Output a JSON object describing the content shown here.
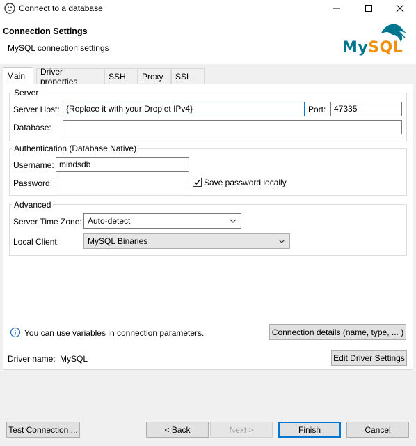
{
  "window": {
    "title": "Connect to a database"
  },
  "header": {
    "title": "Connection Settings",
    "subtitle": "MySQL connection settings",
    "logo_text": "MySQL"
  },
  "tabs": [
    {
      "label": "Main",
      "active": true
    },
    {
      "label": "Driver properties",
      "active": false
    },
    {
      "label": "SSH",
      "active": false
    },
    {
      "label": "Proxy",
      "active": false
    },
    {
      "label": "SSL",
      "active": false
    }
  ],
  "server": {
    "legend": "Server",
    "host_label": "Server Host:",
    "host_value": "{Replace it with your Droplet IPv4}",
    "port_label": "Port:",
    "port_value": "47335",
    "database_label": "Database:",
    "database_value": ""
  },
  "auth": {
    "legend": "Authentication (Database Native)",
    "username_label": "Username:",
    "username_value": "mindsdb",
    "password_label": "Password:",
    "password_value": "",
    "save_password_label": "Save password locally",
    "save_password_checked": true
  },
  "advanced": {
    "legend": "Advanced",
    "timezone_label": "Server Time Zone:",
    "timezone_value": "Auto-detect",
    "local_client_label": "Local Client:",
    "local_client_value": "MySQL Binaries"
  },
  "info": {
    "text": "You can use variables in connection parameters.",
    "details_button": "Connection details (name, type, ... )"
  },
  "driver": {
    "label": "Driver name:",
    "value": "MySQL",
    "edit_button": "Edit Driver Settings"
  },
  "footer": {
    "test_button": "Test Connection ...",
    "back_button": "< Back",
    "next_button": "Next >",
    "finish_button": "Finish",
    "cancel_button": "Cancel"
  },
  "colors": {
    "accent": "#0078d7",
    "mysql_blue": "#00758f",
    "mysql_orange": "#f29111",
    "info_blue": "#1a6fc4"
  },
  "icons": [
    "dbeaver-app-icon",
    "minimize-icon",
    "maximize-icon",
    "close-icon",
    "mysql-dolphin-logo",
    "chevron-down-icon",
    "info-icon",
    "checkmark-icon"
  ]
}
